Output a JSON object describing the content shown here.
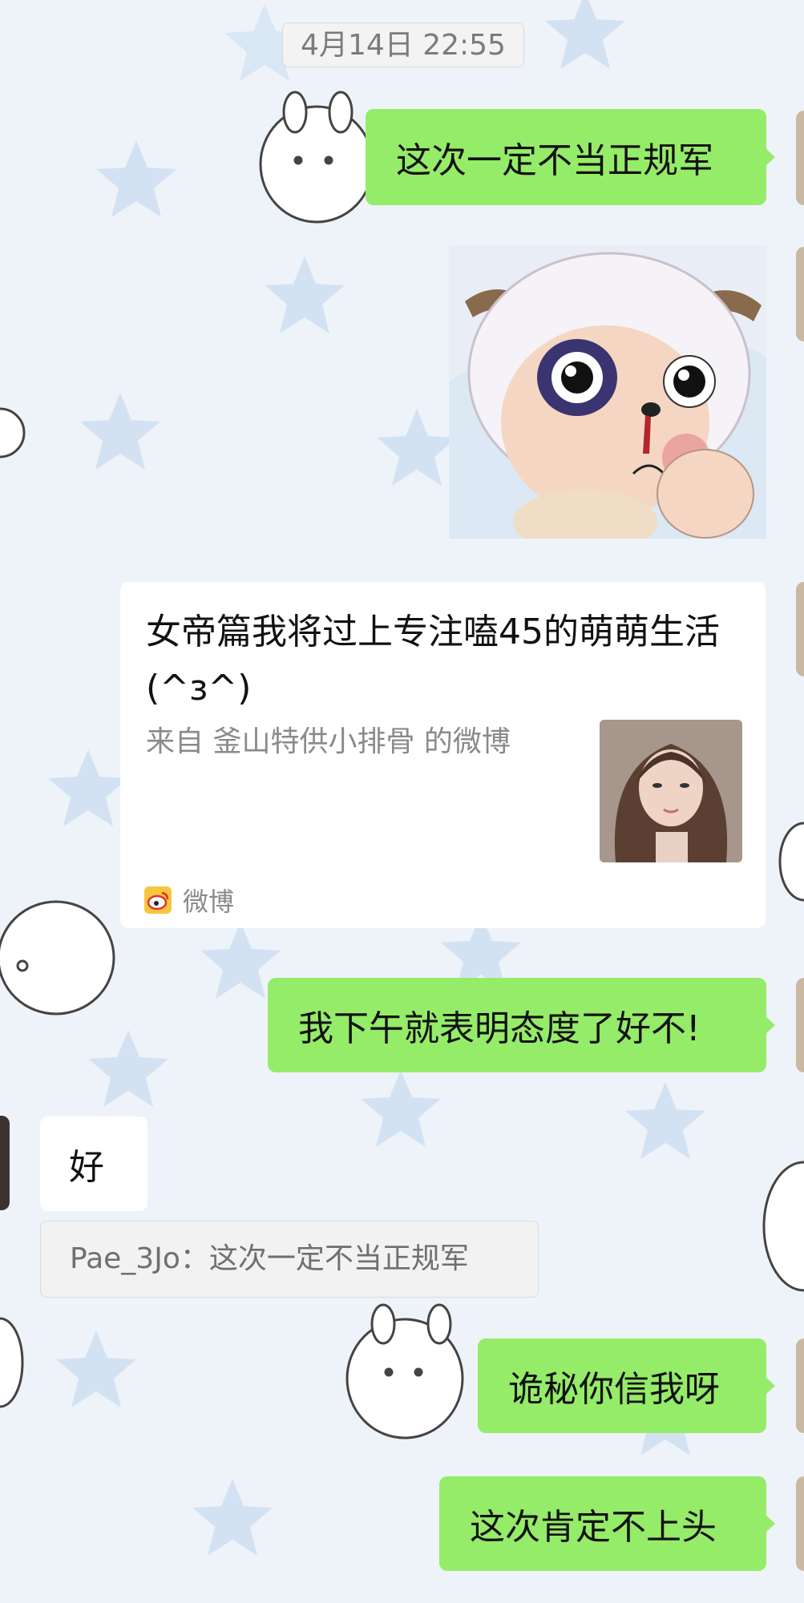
{
  "timestamp": "4月14日 22:55",
  "messages": [
    {
      "side": "out",
      "type": "text",
      "text": "这次一定不当正规军"
    },
    {
      "side": "out",
      "type": "sticker",
      "sticker": "sheep-with-black-eye-sticker"
    },
    {
      "side": "out",
      "type": "link_card",
      "title": "女帝篇我将过上专注嗑45的萌萌生活(^з^)",
      "subtitle": "来自 釜山特供小排骨 的微博",
      "source": "微博",
      "source_icon": "weibo-icon",
      "thumbnail": "woman-portrait-thumbnail"
    },
    {
      "side": "out",
      "type": "text",
      "text": "我下午就表明态度了好不!"
    },
    {
      "side": "in",
      "type": "text",
      "text": "好",
      "quote": "Pae_3Jo：这次一定不当正规军"
    },
    {
      "side": "out",
      "type": "text",
      "text": "诡秘你信我呀"
    },
    {
      "side": "out",
      "type": "text",
      "text": "这次肯定不上头"
    }
  ],
  "colors": {
    "outgoing_bubble": "#95ec69",
    "incoming_bubble": "#ffffff",
    "background": "#eef3f9",
    "background_star": "#cfe0f2",
    "muted_text": "#8a8a8a"
  }
}
